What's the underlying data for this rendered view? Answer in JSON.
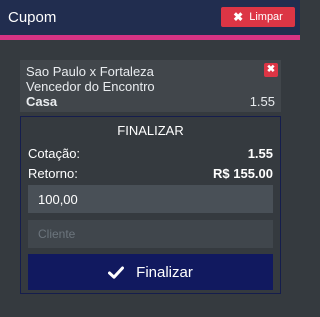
{
  "header": {
    "title": "Cupom",
    "clear_label": "Limpar",
    "clear_icon": "close-icon"
  },
  "colors": {
    "header_bg": "#212d4f",
    "accent": "#d63384",
    "danger": "#dc3545",
    "primary_button": "#11195f",
    "background": "#353a3f"
  },
  "bet": {
    "match": "Sao Paulo x Fortaleza",
    "market": "Vencedor do Encontro",
    "selection": "Casa",
    "odd": "1.55",
    "remove_icon": "close-icon"
  },
  "finalize": {
    "title": "FINALIZAR",
    "odds_label": "Cotação:",
    "odds_value": "1.55",
    "return_label": "Retorno:",
    "return_value": "R$ 155.00",
    "stake_value": "100,00",
    "client_placeholder": "Cliente",
    "button_label": "Finalizar",
    "button_icon": "check-icon"
  }
}
